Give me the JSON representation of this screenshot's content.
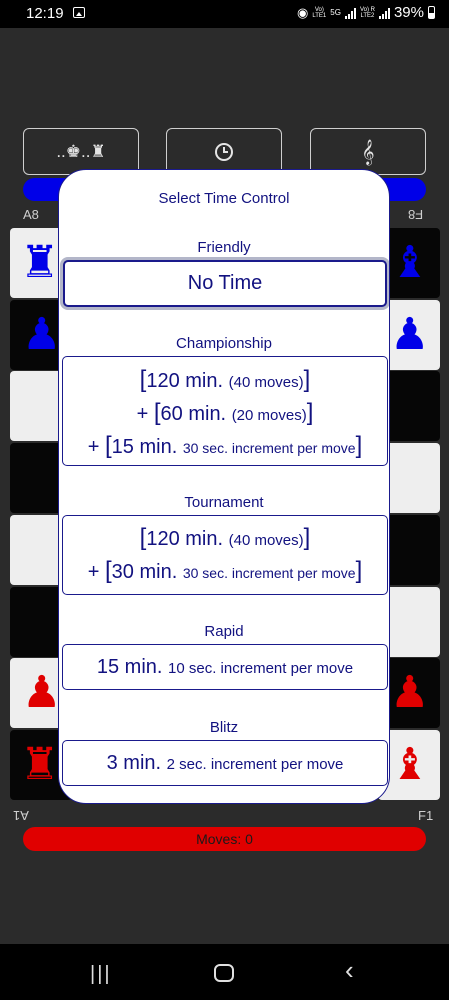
{
  "status_bar": {
    "time": "12:19",
    "net_volte1": "Vo)",
    "net_lte1": "LTE1",
    "net_5g": "5G",
    "net_volte2": "Vo) R",
    "net_lte2": "LTE2",
    "battery": "39%"
  },
  "toolbar": {
    "board_button": "..♚..♜",
    "clock_icon": "clock-icon",
    "sound_icon": "music-icon"
  },
  "board": {
    "coord_top_left": "A8",
    "coord_top_right": "F8",
    "coord_bottom_left": "A1",
    "coord_bottom_right": "F1",
    "moves_label": "Moves: 0"
  },
  "dialog": {
    "title": "Select Time Control",
    "categories": [
      {
        "name": "Friendly",
        "options": [
          {
            "main": "No Time"
          }
        ]
      },
      {
        "name": "Championship",
        "options": [
          {
            "lines": [
              {
                "prefix": "",
                "main": "120 min.",
                "sub": "(40 moves)"
              },
              {
                "prefix": "+ ",
                "main": "60 min.",
                "sub": "(20 moves)"
              },
              {
                "prefix": "+ ",
                "main": "15 min.",
                "sub": "30 sec. increment per move"
              }
            ]
          }
        ]
      },
      {
        "name": "Tournament",
        "options": [
          {
            "lines": [
              {
                "prefix": "",
                "main": "120 min.",
                "sub": "(40 moves)"
              },
              {
                "prefix": "+ ",
                "main": "30 min.",
                "sub": "30 sec. increment per move"
              }
            ]
          }
        ]
      },
      {
        "name": "Rapid",
        "options": [
          {
            "main": "15 min.",
            "sub": "10 sec. increment per move"
          }
        ]
      },
      {
        "name": "Blitz",
        "options": [
          {
            "main": "3 min.",
            "sub": "2 sec. increment per move"
          }
        ]
      }
    ]
  },
  "colors": {
    "dialog_text": "#121280",
    "dialog_border": "#1a1a8c",
    "player_top": "#0000e8",
    "player_bottom": "#e00000"
  },
  "navbar": {
    "recent_icon": "recent-apps-icon",
    "home_icon": "home-icon",
    "back_icon": "back-icon"
  }
}
